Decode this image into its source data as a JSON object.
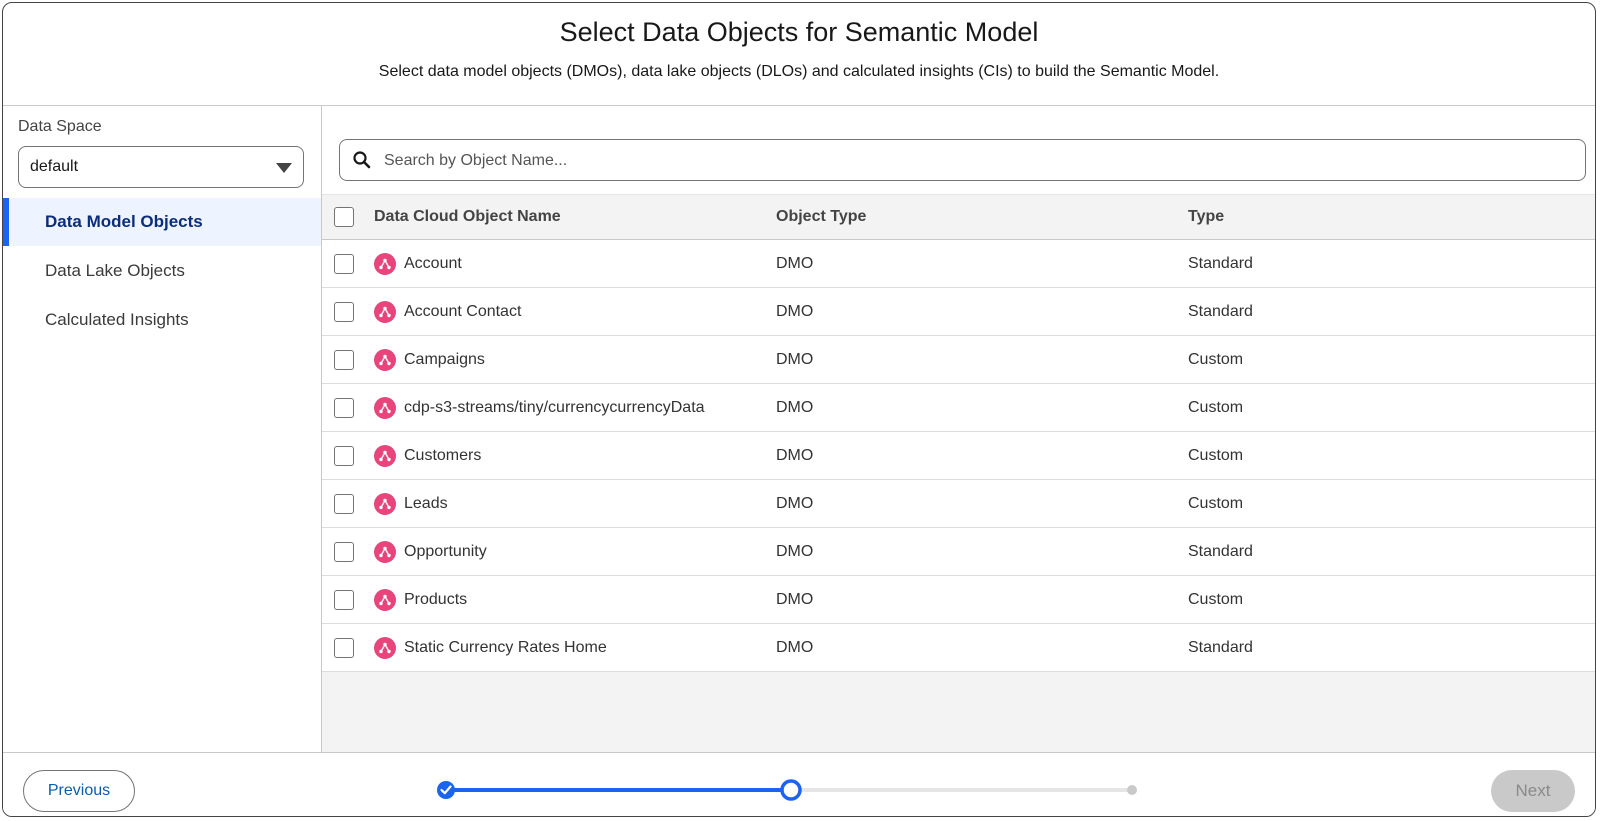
{
  "header": {
    "title": "Select Data Objects for Semantic Model",
    "subtitle": "Select data model objects (DMOs), data lake objects (DLOs) and calculated insights (CIs) to build the Semantic Model."
  },
  "sidebar": {
    "data_space_label": "Data Space",
    "data_space_value": "default",
    "items": [
      {
        "label": "Data Model Objects",
        "active": true
      },
      {
        "label": "Data Lake Objects",
        "active": false
      },
      {
        "label": "Calculated Insights",
        "active": false
      }
    ]
  },
  "search": {
    "placeholder": "Search by Object Name..."
  },
  "table": {
    "headers": {
      "name": "Data Cloud Object Name",
      "object_type": "Object Type",
      "type": "Type"
    },
    "rows": [
      {
        "name": "Account",
        "object_type": "DMO",
        "type": "Standard"
      },
      {
        "name": "Account Contact",
        "object_type": "DMO",
        "type": "Standard"
      },
      {
        "name": "Campaigns",
        "object_type": "DMO",
        "type": "Custom"
      },
      {
        "name": "cdp-s3-streams/tiny/currencycurrencyData",
        "object_type": "DMO",
        "type": "Custom"
      },
      {
        "name": "Customers",
        "object_type": "DMO",
        "type": "Custom"
      },
      {
        "name": "Leads",
        "object_type": "DMO",
        "type": "Custom"
      },
      {
        "name": "Opportunity",
        "object_type": "DMO",
        "type": "Standard"
      },
      {
        "name": "Products",
        "object_type": "DMO",
        "type": "Custom"
      },
      {
        "name": "Static Currency Rates Home",
        "object_type": "DMO",
        "type": "Standard"
      }
    ]
  },
  "footer": {
    "previous_label": "Previous",
    "next_label": "Next"
  },
  "colors": {
    "accent": "#1b64f0",
    "dmo_icon": "#e8457c",
    "nav_active_bg": "#eef4ff"
  }
}
